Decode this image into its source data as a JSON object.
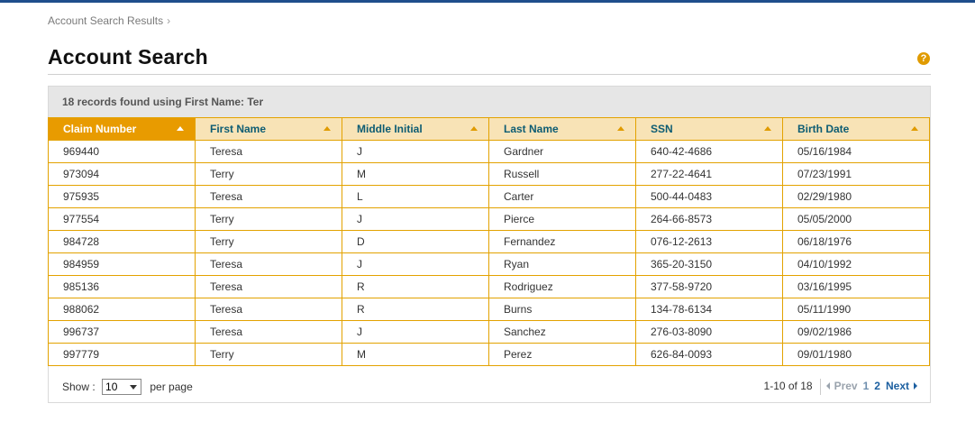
{
  "breadcrumb": {
    "label": "Account Search Results",
    "separator": "›"
  },
  "page": {
    "title": "Account Search",
    "help_icon": "question-circle-icon",
    "help_glyph": "?"
  },
  "results": {
    "summary": "18 records found using First Name: Ter"
  },
  "table": {
    "columns": [
      {
        "label": "Claim Number",
        "active": true
      },
      {
        "label": "First Name",
        "active": false
      },
      {
        "label": "Middle Initial",
        "active": false
      },
      {
        "label": "Last Name",
        "active": false
      },
      {
        "label": "SSN",
        "active": false
      },
      {
        "label": "Birth Date",
        "active": false
      }
    ],
    "rows": [
      [
        "969440",
        "Teresa",
        "J",
        "Gardner",
        "640-42-4686",
        "05/16/1984"
      ],
      [
        "973094",
        "Terry",
        "M",
        "Russell",
        "277-22-4641",
        "07/23/1991"
      ],
      [
        "975935",
        "Teresa",
        "L",
        "Carter",
        "500-44-0483",
        "02/29/1980"
      ],
      [
        "977554",
        "Terry",
        "J",
        "Pierce",
        "264-66-8573",
        "05/05/2000"
      ],
      [
        "984728",
        "Terry",
        "D",
        "Fernandez",
        "076-12-2613",
        "06/18/1976"
      ],
      [
        "984959",
        "Teresa",
        "J",
        "Ryan",
        "365-20-3150",
        "04/10/1992"
      ],
      [
        "985136",
        "Teresa",
        "R",
        "Rodriguez",
        "377-58-9720",
        "03/16/1995"
      ],
      [
        "988062",
        "Teresa",
        "R",
        "Burns",
        "134-78-6134",
        "05/11/1990"
      ],
      [
        "996737",
        "Teresa",
        "J",
        "Sanchez",
        "276-03-8090",
        "09/02/1986"
      ],
      [
        "997779",
        "Terry",
        "M",
        "Perez",
        "626-84-0093",
        "09/01/1980"
      ]
    ]
  },
  "footer": {
    "show_label": "Show :",
    "per_page_value": "10",
    "per_page_label": "per page",
    "range": "1-10 of 18",
    "prev_label": "Prev",
    "pages": [
      "1",
      "2"
    ],
    "current_page": "1",
    "next_label": "Next"
  },
  "colors": {
    "accent": "#e89b00",
    "header_bg": "#f8e3b6",
    "link": "#1c5fa0",
    "topbar": "#1f4e8c"
  }
}
